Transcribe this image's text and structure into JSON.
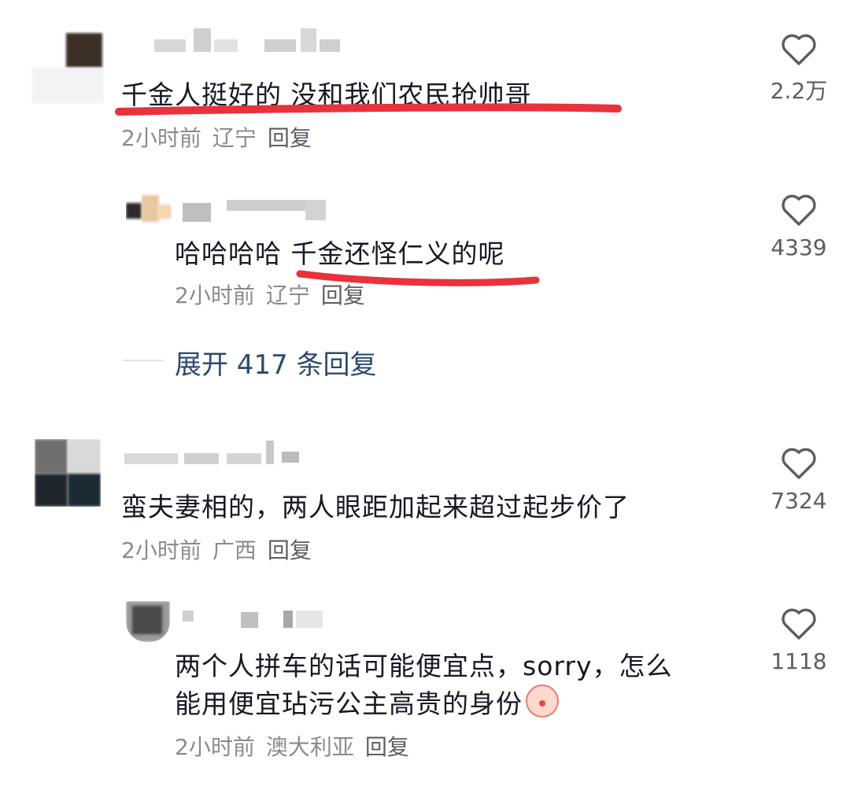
{
  "comments": [
    {
      "text": "千金人挺好的 没和我们农民抢帅哥",
      "time": "2小时前",
      "location": "辽宁",
      "reply": "回复",
      "likes": "2.2万"
    },
    {
      "text": "哈哈哈哈 千金还怪仁义的呢",
      "time": "2小时前",
      "location": "辽宁",
      "reply": "回复",
      "likes": "4339"
    },
    {
      "text": "蛮夫妻相的，两人眼距加起来超过起步价了",
      "time": "2小时前",
      "location": "广西",
      "reply": "回复",
      "likes": "7324"
    },
    {
      "text_line1": "两个人拼车的话可能便宜点，sorry，怎么",
      "text_line2": "能用便宜玷污公主高贵的身份",
      "time": "2小时前",
      "location": "澳大利亚",
      "reply": "回复",
      "likes": "1118"
    }
  ],
  "expand_replies": "展开 417 条回复",
  "colors": {
    "underline": "#e8323c",
    "link": "#2d4a6e",
    "meta": "#8a8b91"
  },
  "icons": [
    "heart-outline-icon",
    "blush-emoji-icon"
  ]
}
